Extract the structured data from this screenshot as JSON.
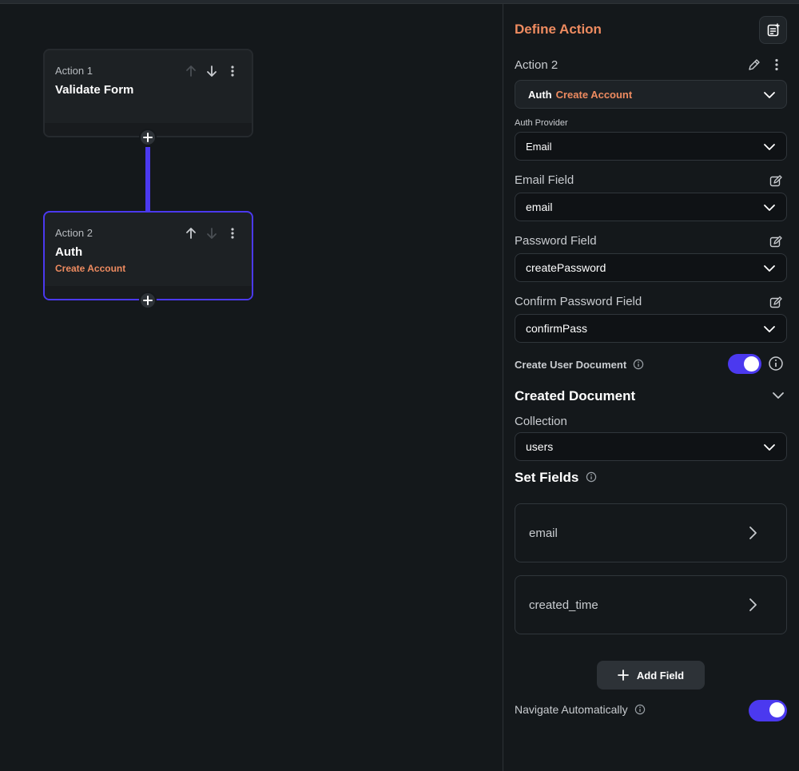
{
  "canvas": {
    "nodes": [
      {
        "head": "Action 1",
        "title": "Validate Form",
        "sub": ""
      },
      {
        "head": "Action 2",
        "title": "Auth",
        "sub": "Create Account"
      }
    ]
  },
  "panel": {
    "title": "Define Action",
    "action_label": "Action 2",
    "action_type": {
      "prefix": "Auth",
      "value": "Create Account"
    },
    "auth_provider": {
      "label": "Auth Provider",
      "value": "Email"
    },
    "email_field": {
      "label": "Email Field",
      "value": "email"
    },
    "password_field": {
      "label": "Password Field",
      "value": "createPassword"
    },
    "confirm_password_field": {
      "label": "Confirm Password Field",
      "value": "confirmPass"
    },
    "create_user_document": {
      "label": "Create User Document",
      "on": true
    },
    "created_document": {
      "heading": "Created Document"
    },
    "collection": {
      "label": "Collection",
      "value": "users"
    },
    "set_fields": {
      "heading": "Set Fields",
      "items": [
        "email",
        "created_time"
      ]
    },
    "add_field_label": "Add Field",
    "navigate_automatically": {
      "label": "Navigate Automatically",
      "on": true
    }
  },
  "colors": {
    "accent": "#4b39ef",
    "orange": "#ee8b60",
    "background": "#14181b"
  }
}
